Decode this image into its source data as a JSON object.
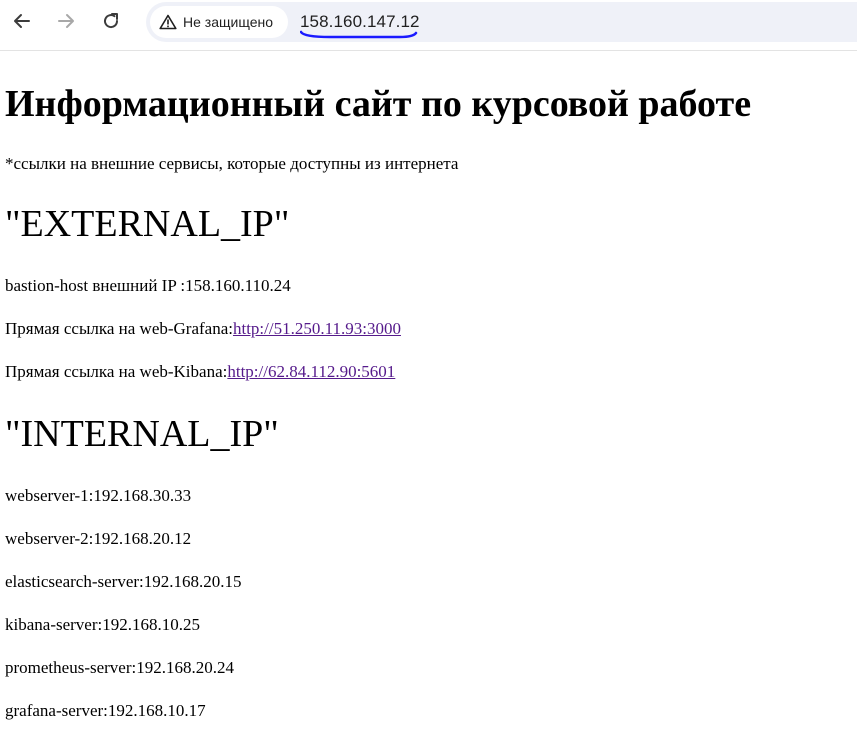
{
  "browser": {
    "security_label": "Не защищено",
    "url": "158.160.147.12",
    "annotation_color": "#1a1aff"
  },
  "page": {
    "title": "Информационный сайт по курсовой работе",
    "note": "*ссылки на внешние сервисы, которые доступны из интернета",
    "external": {
      "heading": "\"EXTERNAL_IP\"",
      "bastion": "bastion-host внешний IP :158.160.110.24",
      "grafana_label": "Прямая ссылка на web-Grafana:",
      "grafana_link": "http://51.250.11.93:3000",
      "kibana_label": "Прямая ссылка на web-Kibana:",
      "kibana_link": "http://62.84.112.90:5601"
    },
    "internal": {
      "heading": "\"INTERNAL_IP\"",
      "items": [
        "webserver-1:192.168.30.33",
        "webserver-2:192.168.20.12",
        "elasticsearch-server:192.168.20.15",
        "kibana-server:192.168.10.25",
        "prometheus-server:192.168.20.24",
        "grafana-server:192.168.10.17"
      ]
    }
  }
}
